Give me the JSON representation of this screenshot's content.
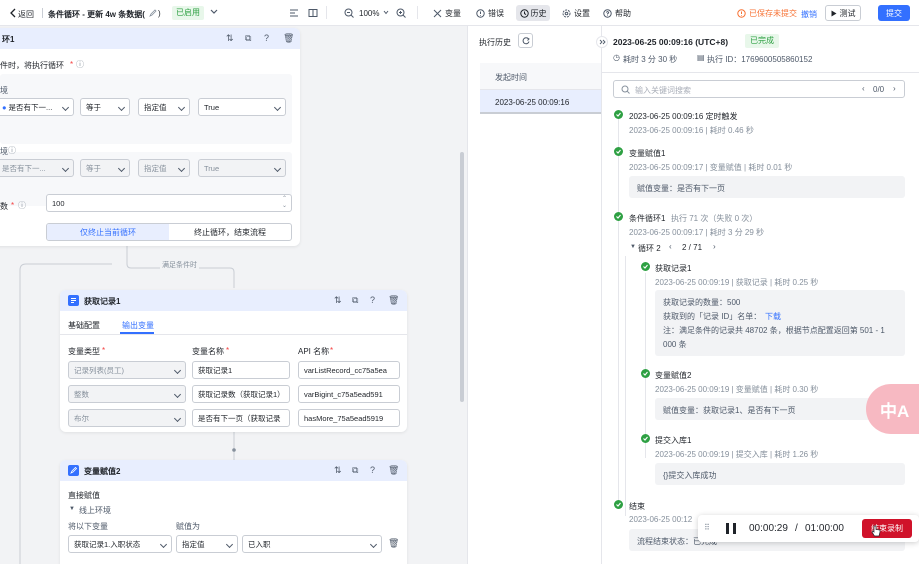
{
  "topbar": {
    "back": "返回",
    "title": "条件循环 - 更新 4w 条数据(",
    "version_tail": ")",
    "status": "已启用",
    "zoom": "100%",
    "tools": [
      "变量",
      "错误",
      "历史",
      "设置",
      "帮助"
    ],
    "saved_status": "已保存未提交",
    "revoke": "撤销",
    "test": "测试",
    "submit": "提交"
  },
  "loop_card": {
    "title": "环1",
    "cond_label": "件时，将执行循环",
    "env1": "境",
    "env2": "境",
    "row1": [
      "是否有下一...",
      "等于",
      "指定值",
      "True"
    ],
    "row2": [
      "是否有下一...",
      "等于",
      "指定值",
      "True"
    ],
    "max_label": "数",
    "max_value": "100",
    "opt_a": "仅终止当前循环",
    "opt_b": "终止循环，结束流程"
  },
  "edge_label": "满足条件时",
  "fetch_card": {
    "title": "获取记录1",
    "tabs": [
      "基础配置",
      "输出变量"
    ],
    "headers": [
      "变量类型",
      "变量名称",
      "API 名称"
    ],
    "rows": [
      [
        "记录列表(员工)",
        "获取记录1",
        "varListRecord_cc75a5ea"
      ],
      [
        "整数",
        "获取记录数（获取记录1）",
        "varBigint_c75a5ead591"
      ],
      [
        "布尔",
        "是否有下一页（获取记录",
        "hasMore_75a5ead5919"
      ]
    ]
  },
  "assign_card": {
    "title": "变量赋值2",
    "section": "直接赋值",
    "env": "线上环境",
    "col_a": "将以下变量",
    "col_b": "赋值为",
    "row": [
      "获取记录1.入职状态",
      "指定值",
      "已入职"
    ]
  },
  "history": {
    "title": "执行历史",
    "col": "发起时间",
    "row": "2023-06-25 00:09:16"
  },
  "detail": {
    "time": "2023-06-25 00:09:16 (UTC+8)",
    "status": "已完成",
    "duration": "耗时 3 分 30 秒",
    "exec_id": "执行 ID：1769600505860152",
    "search_ph": "输入关键词搜索",
    "search_count": "0/0",
    "steps": [
      {
        "title": "2023-06-25 00:09:16 定时触发",
        "meta": "2023-06-25 00:09:16 | 耗时 0.46 秒"
      },
      {
        "title": "变量赋值1",
        "meta": "2023-06-25 00:09:17 | 变量赋值 | 耗时 0.01 秒",
        "box": "赋值变量：是否有下一页"
      },
      {
        "title": "条件循环1",
        "extra": "执行 71 次（失败 0 次）",
        "meta": "2023-06-25 00:09:17 | 耗时 3 分 29 秒"
      }
    ],
    "loop_label": "循环 2",
    "loop_page": "2 / 71",
    "sub": [
      {
        "title": "获取记录1",
        "meta": "2023-06-25 00:09:19 | 获取记录 | 耗时 0.25 秒",
        "l1": "获取记录的数量：500",
        "l2a": "获取到的「记录 ID」名单：",
        "l2b": "下载",
        "l3": "注：满足条件的记录共 48702 条，根据节点配置返回第 501 - 1",
        "l4": "000 条"
      },
      {
        "title": "变量赋值2",
        "meta": "2023-06-25 00:09:19 | 变量赋值 | 耗时 0.30 秒",
        "box": "赋值变量：获取记录1、是否有下一页"
      },
      {
        "title": "提交入库1",
        "meta": "2023-06-25 00:09:19 | 提交入库 | 耗时 1.26 秒",
        "box": "{}提交入库成功"
      }
    ],
    "end_title": "结束",
    "end_meta": "2023-06-25 00:12",
    "end_box": "流程结束状态：已完成"
  },
  "recorder": {
    "elapsed": "00:00:29",
    "sep": "/",
    "total": "01:00:00",
    "stop": "结束录制"
  },
  "translate_badge": "中A"
}
